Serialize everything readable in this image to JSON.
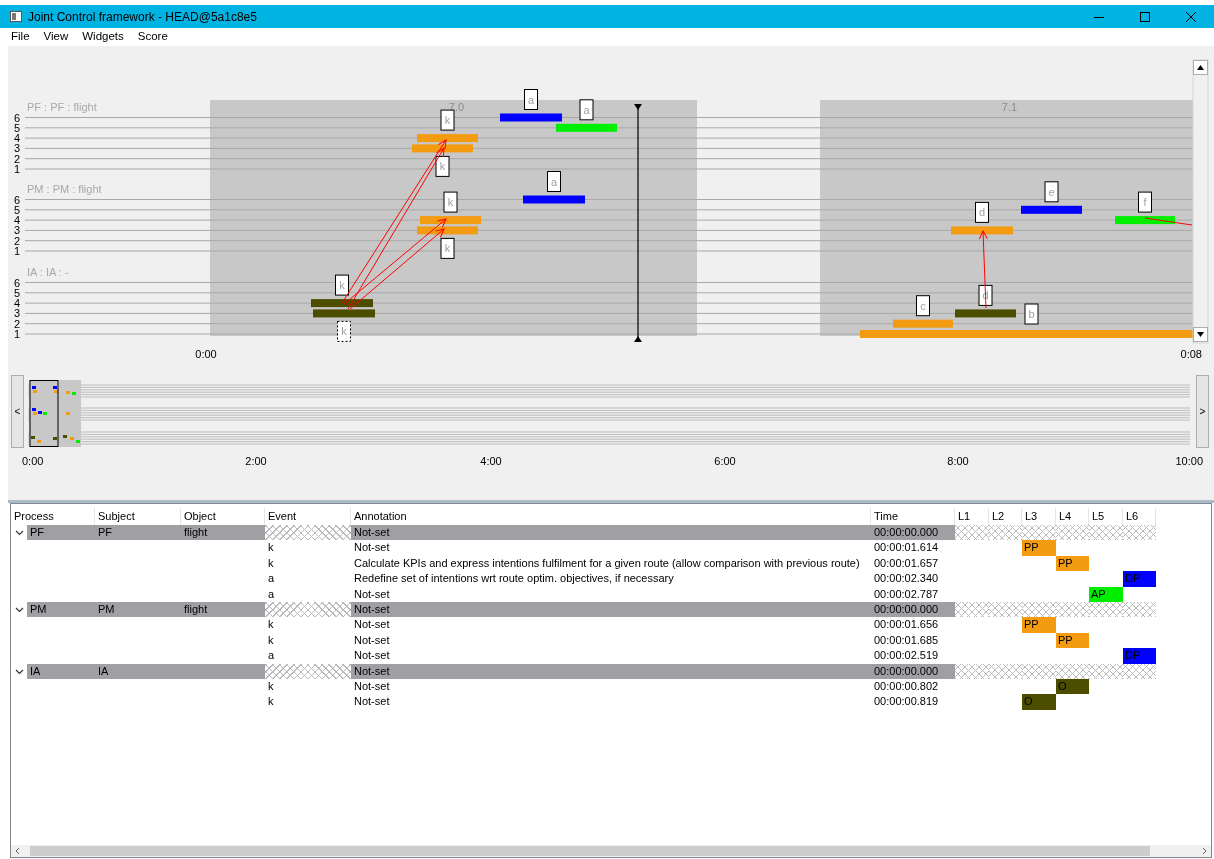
{
  "window": {
    "title": "Joint Control framework - HEAD@5a1c8e5"
  },
  "menu": [
    "File",
    "View",
    "Widgets",
    "Score"
  ],
  "timeline": {
    "groups": [
      {
        "label": "PF : PF : flight",
        "lanes": [
          "6",
          "5",
          "4",
          "3",
          "2",
          "1"
        ]
      },
      {
        "label": "PM : PM : flight",
        "lanes": [
          "6",
          "5",
          "4",
          "3",
          "2",
          "1"
        ]
      },
      {
        "label": "IA : IA : -",
        "lanes": [
          "6",
          "5",
          "4",
          "3",
          "2",
          "1"
        ]
      }
    ],
    "segments": [
      {
        "label": "7.0"
      },
      {
        "label": "7.1"
      }
    ],
    "bars": [
      {
        "tag": "k",
        "color": "#f39c12",
        "selected": false
      },
      {
        "tag": "k",
        "color": "#f39c12",
        "selected": false
      },
      {
        "tag": "a",
        "color": "#0000ff",
        "selected": false
      },
      {
        "tag": "a",
        "color": "#00ee00",
        "selected": false
      },
      {
        "tag": "a",
        "color": "#0000ff",
        "selected": false
      },
      {
        "tag": "k",
        "color": "#f39c12",
        "selected": false
      },
      {
        "tag": "k",
        "color": "#f39c12",
        "selected": false
      },
      {
        "tag": "k",
        "color": "#4d4d00",
        "selected": false
      },
      {
        "tag": "k",
        "color": "#4d4d00",
        "selected": true
      },
      {
        "tag": "d",
        "color": "#f39c12",
        "selected": false
      },
      {
        "tag": "e",
        "color": "#0000ff",
        "selected": false
      },
      {
        "tag": "f",
        "color": "#00ee00",
        "selected": false
      },
      {
        "tag": "d",
        "color": "#4d4d00",
        "selected": false
      },
      {
        "tag": "c",
        "color": "#f39c12",
        "selected": false
      },
      {
        "tag": "b",
        "color": "#f39c12",
        "selected": false
      }
    ],
    "axis_start": "0:00",
    "axis_end": "0:08"
  },
  "overview": {
    "scroll_left": "<",
    "scroll_right": ">",
    "ticks": [
      "0:00",
      "2:00",
      "4:00",
      "6:00",
      "8:00",
      "10:00"
    ]
  },
  "table": {
    "columns": [
      "Process",
      "Subject",
      "Object",
      "Event",
      "Annotation",
      "Time",
      "L1",
      "L2",
      "L3",
      "L4",
      "L5",
      "L6"
    ],
    "rows": [
      {
        "kind": "group",
        "expanded": true,
        "process": "PF",
        "subject": "PF",
        "object": "flight",
        "annotation": "Not-set",
        "time": "00:00:00.000"
      },
      {
        "kind": "event",
        "event": "k",
        "annotation": "Not-set",
        "time": "00:00:01.614",
        "l3": {
          "text": "PP",
          "color": "#f39c12"
        }
      },
      {
        "kind": "event",
        "event": "k",
        "annotation": "Calculate KPIs and express intentions fulfilment for a given route (allow comparison with previous route)",
        "time": "00:00:01.657",
        "l4": {
          "text": "PP",
          "color": "#f39c12"
        }
      },
      {
        "kind": "event",
        "event": "a",
        "annotation": "Redefine set of intentions wrt route optim. objectives, if necessary",
        "time": "00:00:02.340",
        "l6": {
          "text": "DP",
          "color": "#0000ff"
        }
      },
      {
        "kind": "event",
        "event": "a",
        "annotation": "Not-set",
        "time": "00:00:02.787",
        "l5": {
          "text": "AP",
          "color": "#00ee00"
        }
      },
      {
        "kind": "group",
        "expanded": true,
        "process": "PM",
        "subject": "PM",
        "object": "flight",
        "annotation": "Not-set",
        "time": "00:00:00.000"
      },
      {
        "kind": "event",
        "event": "k",
        "annotation": "Not-set",
        "time": "00:00:01.656",
        "l3": {
          "text": "PP",
          "color": "#f39c12"
        }
      },
      {
        "kind": "event",
        "event": "k",
        "annotation": "Not-set",
        "time": "00:00:01.685",
        "l4": {
          "text": "PP",
          "color": "#f39c12"
        }
      },
      {
        "kind": "event",
        "event": "a",
        "annotation": "Not-set",
        "time": "00:00:02.519",
        "l6": {
          "text": "DP",
          "color": "#0000ff"
        }
      },
      {
        "kind": "group",
        "expanded": true,
        "process": "IA",
        "subject": "IA",
        "annotation": "Not-set",
        "time": "00:00:00.000"
      },
      {
        "kind": "event",
        "event": "k",
        "annotation": "Not-set",
        "time": "00:00:00.802",
        "l4": {
          "text": "O",
          "color": "#4d4d00"
        }
      },
      {
        "kind": "event",
        "event": "k",
        "annotation": "Not-set",
        "time": "00:00:00.819",
        "l3": {
          "text": "O",
          "color": "#4d4d00"
        }
      }
    ]
  }
}
